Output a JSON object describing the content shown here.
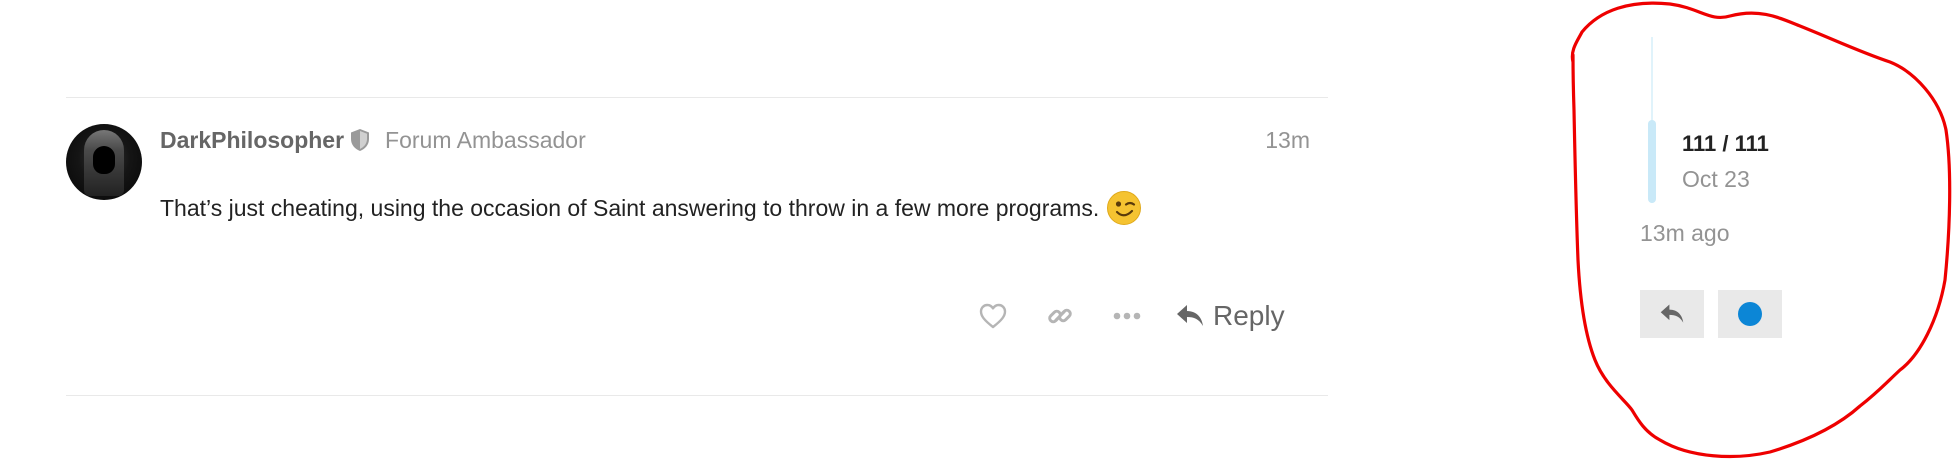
{
  "post": {
    "username": "DarkPhilosopher",
    "user_title": "Forum Ambassador",
    "time": "13m",
    "body": "That’s just cheating, using the occasion of Saint answering to throw in a few more programs.",
    "emoji_icon": "winking-face-icon",
    "actions": {
      "like_icon": "heart-icon",
      "share_icon": "link-icon",
      "more_icon": "ellipsis-icon",
      "reply_label": "Reply"
    }
  },
  "timeline": {
    "position": "111 / 111",
    "date": "Oct 23",
    "ago": "13m ago",
    "reply_icon": "reply-icon",
    "notification_icon": "blue-dot-icon"
  },
  "colors": {
    "text": "#222222",
    "muted": "#939393",
    "username": "#666666",
    "accent_blue": "#0c86d6",
    "timeline_handle": "#c9e9f8",
    "annotation_red": "#ee0000",
    "button_bg": "#e9e9e9"
  }
}
